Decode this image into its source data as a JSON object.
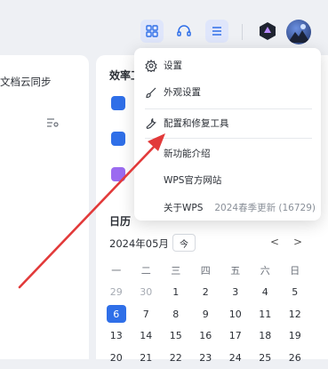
{
  "toolbar": {
    "icons": [
      "grid-icon",
      "headset-icon",
      "menu-icon",
      "badge-icon",
      "avatar"
    ]
  },
  "left_panel": {
    "sync_text": "文档云同步"
  },
  "right_panel": {
    "efficiency_title": "效率工",
    "calendar": {
      "title": "日历",
      "month_label": "2024年05月",
      "today_label": "今",
      "prev": "<",
      "next": ">",
      "weekdays": [
        "一",
        "二",
        "三",
        "四",
        "五",
        "六",
        "日"
      ],
      "days": [
        [
          "29",
          "30",
          "1",
          "2",
          "3",
          "4",
          "5"
        ],
        [
          "6",
          "7",
          "8",
          "9",
          "10",
          "11",
          "12"
        ],
        [
          "13",
          "14",
          "15",
          "16",
          "17",
          "18",
          "19"
        ],
        [
          "20",
          "21",
          "22",
          "23",
          "24",
          "25",
          "26"
        ]
      ],
      "selected_day": "6"
    }
  },
  "menu": {
    "items": [
      {
        "label": "设置",
        "icon": "gear-icon"
      },
      {
        "label": "外观设置",
        "icon": "brush-icon"
      },
      {
        "label": "配置和修复工具",
        "icon": "wrench-icon"
      },
      {
        "label": "新功能介绍",
        "icon": ""
      },
      {
        "label": "WPS官方网站",
        "icon": ""
      },
      {
        "label": "关于WPS",
        "icon": "",
        "value": "2024春季更新 (16729)"
      }
    ]
  },
  "colors": {
    "accent": "#2f6fe8",
    "arrow": "#e23a3a"
  }
}
